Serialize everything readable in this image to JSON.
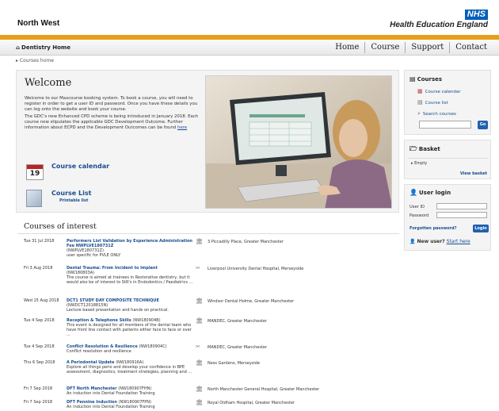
{
  "header": {
    "brand_left": "North West",
    "nhs_logo": "NHS",
    "brand_right": "Health Education England"
  },
  "nav": {
    "home_link": "Dentistry Home",
    "items": [
      "Home",
      "Course",
      "Support",
      "Contact"
    ]
  },
  "breadcrumb": "Courses home",
  "welcome": {
    "title": "Welcome",
    "para1": "Welcome to our Maxcourse booking system. To book a course, you will need to register in order to get a user ID and password. Once you have these details you can log onto the website and book your course.",
    "para2": "The GDC's new Enhanced CPD scheme is being introduced in January 2018. Each course now stipulates the applicable GDC Development Outcome. Further information about ECPD and the Development Outcomes can be found",
    "para2_link": "here",
    "calendar_day": "19",
    "calendar_link": "Course calendar",
    "list_link": "Course List",
    "list_sub": "Printable list"
  },
  "courses": {
    "title": "Courses of interest",
    "rows": [
      {
        "date": "Tue 31 Jul 2018",
        "title": "Performers List Validation by Experience Administration Fee NWPLVE180731Z",
        "code": "(NWPLVE180731Z)",
        "desc": "user specific for PVLE ONLY",
        "icon": "building-icon",
        "location": "3 Piccadilly Place, Greater Manchester"
      },
      {
        "date": "Fri 3 Aug 2018",
        "title": "Dental Trauma: From Incident to Implant",
        "code": "(NW180803A)",
        "desc": "The course is aimed at trainees in Restorative dentistry, but it would also be of interest to StR's in Endodontics / Paediatrics ...",
        "icon": "tools-icon",
        "location": "Liverpool University Dental Hospital, Merseyside"
      },
      {
        "date": "Wed 15 Aug 2018",
        "title": "DCT1 STUDY DAY COMPOSITE TECHNIQUE",
        "code": "(NWDCT12018815N)",
        "desc": "Lecture based presentation and hands on practical.",
        "icon": "building-icon",
        "location": "Windsor Dental Holme, Greater Manchester"
      },
      {
        "date": "Tue 4 Sep 2018",
        "title": "Reception & Telephone Skills",
        "code": "(NW180904B)",
        "desc": "This event is designed for all members of the dental team who have front line contact with patients either face to face or over ...",
        "icon": "building-icon",
        "location": "MANDEC, Greater Manchester"
      },
      {
        "date": "Tue 4 Sep 2018",
        "title": "Conflict Resolution & Resilience",
        "code": "(NW180904C)",
        "desc": "Conflict resolution and resilience",
        "icon": "tools-icon",
        "location": "MANDEC, Greater Manchester"
      },
      {
        "date": "Thu 6 Sep 2018",
        "title": "A Periodontal Update",
        "code": "(NW180916A)",
        "desc": "Explore all things perio and develop your confidence in BPE assessment, diagnostics, treatment strategies, planning and ...",
        "icon": "building-icon",
        "location": "Ness Gardens, Merseyside"
      },
      {
        "date": "Fri 7 Sep 2018",
        "title": "DFT North Manchester",
        "code": "(NW180907FHN)",
        "desc": "An induction into Dental Foundation Training",
        "icon": "building-icon",
        "location": "North Manchester General Hospital, Greater Manchester"
      },
      {
        "date": "Fri 7 Sep 2018",
        "title": "DFT Pennine Induction",
        "code": "(NW180907FPN)",
        "desc": "An induction into Dental Foundation Training",
        "icon": "building-icon",
        "location": "Royal Oldham Hospital, Greater Manchester"
      }
    ]
  },
  "sidebar": {
    "courses_title": "Courses",
    "course_calendar": "Course calendar",
    "course_list": "Course list",
    "search_courses": "Search courses",
    "go": "Go",
    "basket_title": "Basket",
    "basket_empty": "Empty",
    "view_basket": "View basket",
    "login_title": "User login",
    "user_id_label": "User ID",
    "password_label": "Password",
    "forgotten": "Forgotten password?",
    "login_btn": "Login",
    "new_user": "New user?",
    "start_here": "Start here"
  },
  "colors": {
    "accent": "#e8a019",
    "nhs_blue": "#005eb8",
    "link": "#1a4d8f"
  }
}
